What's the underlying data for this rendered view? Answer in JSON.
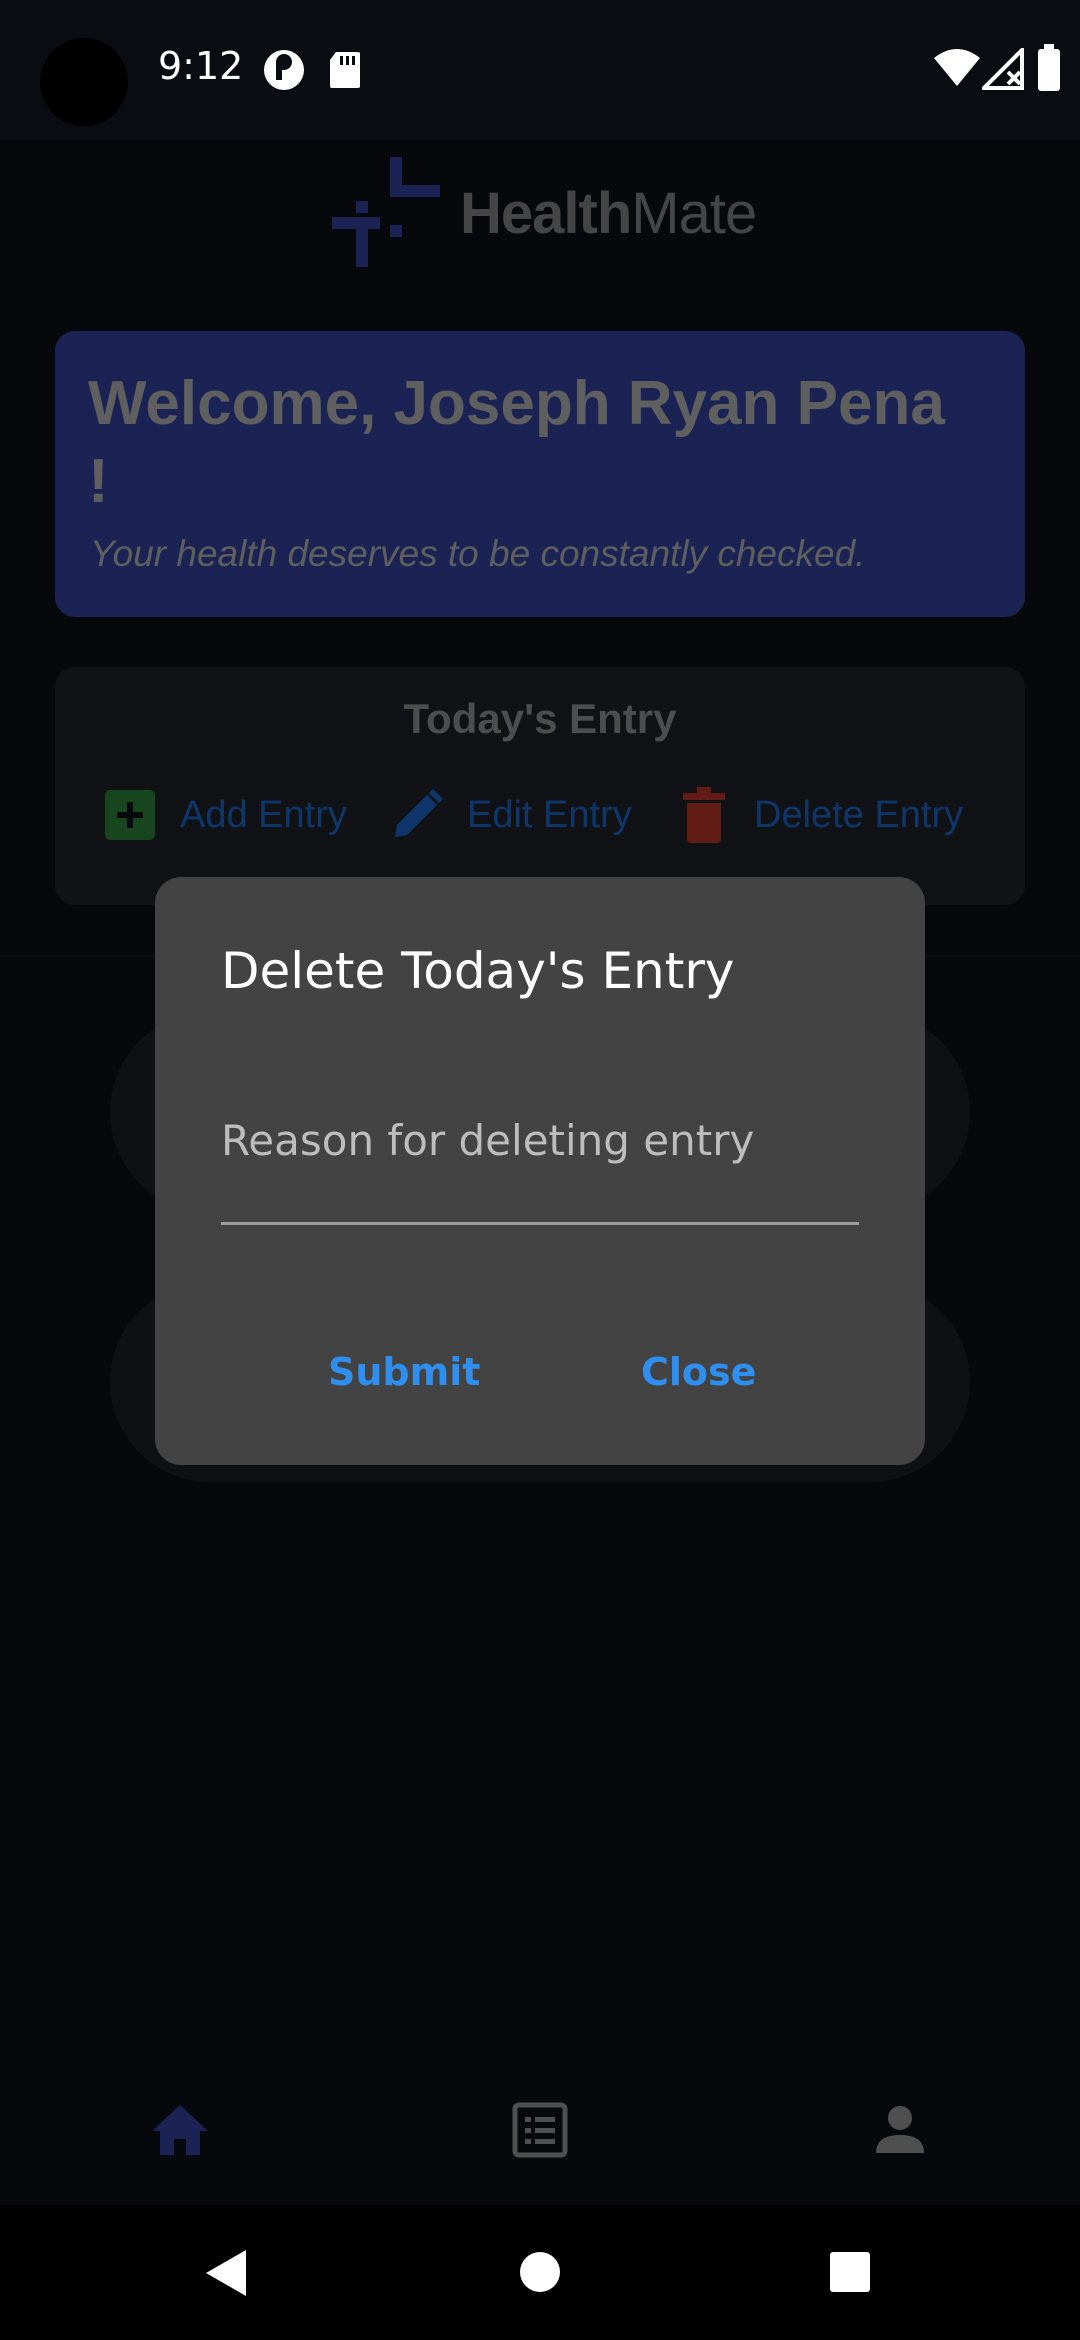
{
  "status_bar": {
    "time": "9:12",
    "icons_left": [
      "pocket-casts-icon",
      "sd-card-icon"
    ],
    "icons_right": [
      "wifi-icon",
      "no-signal-icon",
      "battery-icon"
    ]
  },
  "app": {
    "logo_bold": "Health",
    "logo_light": "Mate",
    "welcome_title": "Welcome, Joseph Ryan Pena !",
    "welcome_subtitle": "Your health deserves to be constantly checked.",
    "entry_title": "Today's Entry",
    "actions": [
      {
        "label": "Add Entry",
        "icon": "add-box-icon"
      },
      {
        "label": "Edit Entry",
        "icon": "pencil-icon"
      },
      {
        "label": "Delete Entry",
        "icon": "trash-icon"
      }
    ]
  },
  "dialog": {
    "title": "Delete Today's Entry",
    "input_placeholder": "Reason for deleting entry",
    "input_value": "",
    "submit_label": "Submit",
    "close_label": "Close"
  },
  "bottom_nav": {
    "items": [
      "home-icon",
      "list-icon",
      "person-icon"
    ],
    "active": "home-icon"
  },
  "system_nav": [
    "back-icon",
    "home-circle-icon",
    "recents-icon"
  ],
  "colors": {
    "accent": "#3546a8",
    "dialog_button": "#2f8ff0",
    "add": "#2e8b3a",
    "delete": "#c0392b"
  }
}
